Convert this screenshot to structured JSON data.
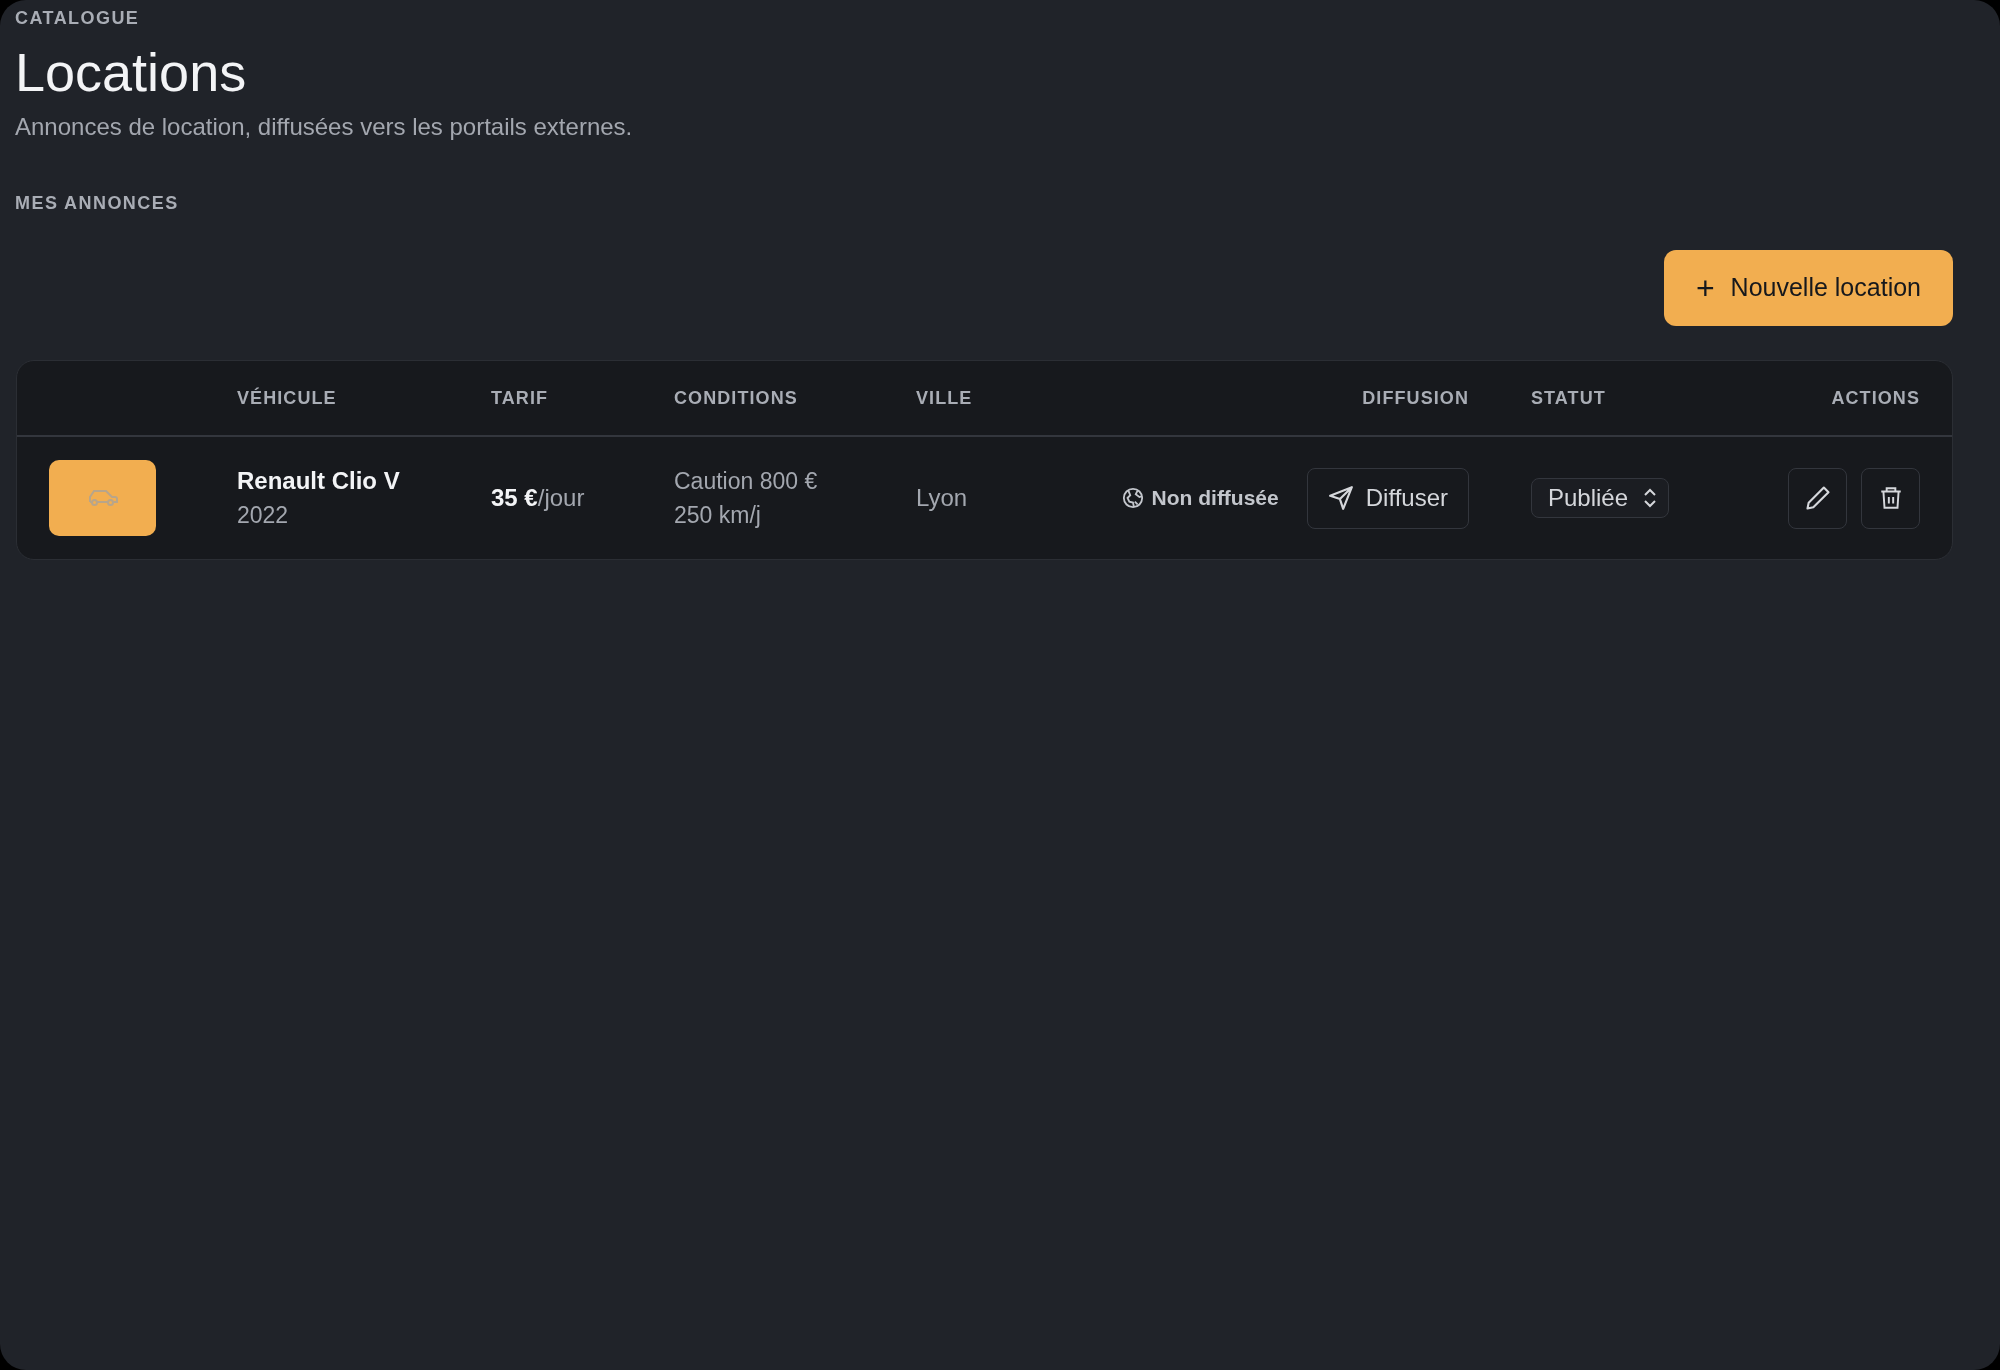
{
  "header": {
    "eyebrow": "CATALOGUE",
    "title": "Locations",
    "subtitle": "Annonces de location, diffusées vers les portails externes."
  },
  "section_title": "MES ANNONCES",
  "new_button": {
    "icon": "+",
    "label": "Nouvelle location"
  },
  "table": {
    "columns": [
      "VÉHICULE",
      "TARIF",
      "CONDITIONS",
      "VILLE",
      "DIFFUSION",
      "STATUT",
      "ACTIONS"
    ],
    "rows": [
      {
        "vehicle": "Renault Clio V",
        "year": "2022",
        "price": "35 €",
        "price_unit": "/jour",
        "conditions": [
          "Caution 800 €",
          "250 km/j"
        ],
        "city": "Lyon",
        "diffusion_status": "Non diffusée",
        "diffuse_button": "Diffuser",
        "status": "Publiée"
      }
    ]
  }
}
